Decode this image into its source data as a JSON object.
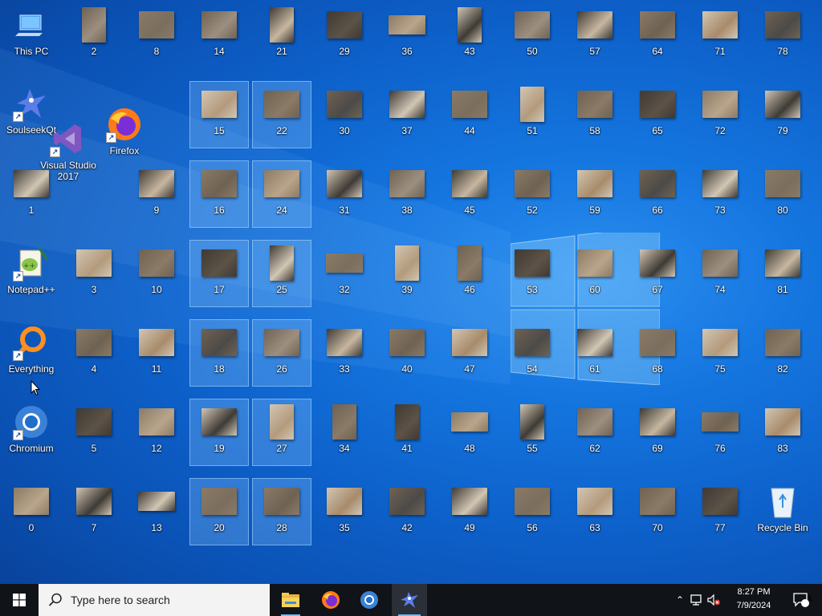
{
  "desktop": {
    "system_icons": [
      {
        "name": "this-pc-icon",
        "label": "This PC"
      },
      {
        "name": "soulseekqt-icon",
        "label": "SoulseekQt"
      },
      {
        "name": "visual-studio-icon",
        "label": "Visual Studio 2017"
      },
      {
        "name": "firefox-icon",
        "label": "Firefox"
      },
      {
        "name": "notepad-plus-plus-icon",
        "label": "Notepad++"
      },
      {
        "name": "everything-icon",
        "label": "Everything"
      },
      {
        "name": "chromium-icon",
        "label": "Chromium"
      },
      {
        "name": "recycle-bin-icon",
        "label": "Recycle Bin"
      }
    ],
    "cat_photos": [
      {
        "label": "0"
      },
      {
        "label": "1"
      },
      {
        "label": "2"
      },
      {
        "label": "3"
      },
      {
        "label": "4"
      },
      {
        "label": "5"
      },
      {
        "label": "7"
      },
      {
        "label": "8"
      },
      {
        "label": "9"
      },
      {
        "label": "10"
      },
      {
        "label": "11"
      },
      {
        "label": "12"
      },
      {
        "label": "13"
      },
      {
        "label": "14"
      },
      {
        "label": "15"
      },
      {
        "label": "16"
      },
      {
        "label": "17"
      },
      {
        "label": "18"
      },
      {
        "label": "19"
      },
      {
        "label": "20"
      },
      {
        "label": "21"
      },
      {
        "label": "22"
      },
      {
        "label": "24"
      },
      {
        "label": "25"
      },
      {
        "label": "26"
      },
      {
        "label": "27"
      },
      {
        "label": "28"
      },
      {
        "label": "29"
      },
      {
        "label": "30"
      },
      {
        "label": "31"
      },
      {
        "label": "32"
      },
      {
        "label": "33"
      },
      {
        "label": "34"
      },
      {
        "label": "35"
      },
      {
        "label": "36"
      },
      {
        "label": "37"
      },
      {
        "label": "38"
      },
      {
        "label": "39"
      },
      {
        "label": "40"
      },
      {
        "label": "41"
      },
      {
        "label": "42"
      },
      {
        "label": "43"
      },
      {
        "label": "44"
      },
      {
        "label": "45"
      },
      {
        "label": "46"
      },
      {
        "label": "47"
      },
      {
        "label": "48"
      },
      {
        "label": "49"
      },
      {
        "label": "50"
      },
      {
        "label": "51"
      },
      {
        "label": "52"
      },
      {
        "label": "53"
      },
      {
        "label": "54"
      },
      {
        "label": "55"
      },
      {
        "label": "56"
      },
      {
        "label": "57"
      },
      {
        "label": "58"
      },
      {
        "label": "59"
      },
      {
        "label": "60"
      },
      {
        "label": "61"
      },
      {
        "label": "62"
      },
      {
        "label": "63"
      },
      {
        "label": "64"
      },
      {
        "label": "65"
      },
      {
        "label": "66"
      },
      {
        "label": "67"
      },
      {
        "label": "68"
      },
      {
        "label": "69"
      },
      {
        "label": "70"
      },
      {
        "label": "71"
      },
      {
        "label": "72"
      },
      {
        "label": "73"
      },
      {
        "label": "74"
      },
      {
        "label": "75"
      },
      {
        "label": "76"
      },
      {
        "label": "77"
      },
      {
        "label": "78"
      },
      {
        "label": "79"
      },
      {
        "label": "80"
      },
      {
        "label": "81"
      },
      {
        "label": "82"
      },
      {
        "label": "83"
      }
    ]
  },
  "taskbar": {
    "search_placeholder": "Type here to search",
    "pinned": [
      {
        "name": "file-explorer-icon"
      },
      {
        "name": "firefox-icon"
      },
      {
        "name": "chromium-icon"
      },
      {
        "name": "soulseekqt-icon"
      }
    ],
    "clock_time": "8:27 PM",
    "clock_date": "7/9/2024",
    "notification_count": "1"
  },
  "colors": {
    "accent": "#0a64d2",
    "taskbar": "#101318",
    "selection": "#8cc8ff"
  }
}
